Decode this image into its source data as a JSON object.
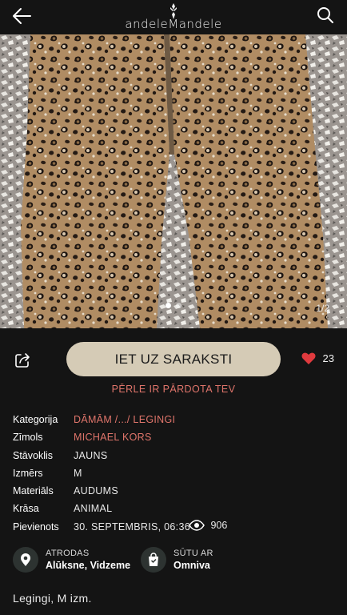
{
  "header": {
    "brand": "andeleMandele",
    "back_icon": "arrow-left-icon",
    "search_icon": "search-icon"
  },
  "gallery": {
    "pager": "1/2",
    "total": 2,
    "current": 1
  },
  "actions": {
    "cta_label": "IET UZ SARAKSTI",
    "likes": "23",
    "sold_note": "PĒRLE IR PĀRDOTA TEV"
  },
  "details": {
    "category_label": "Kategorija",
    "category_value": "DĀMĀM /.../ LEGINGI",
    "brand_label": "Zīmols",
    "brand_value": "MICHAEL KORS",
    "condition_label": "Stāvoklis",
    "condition_value": "JAUNS",
    "size_label": "Izmērs",
    "size_value": "M",
    "material_label": "Materiāls",
    "material_value": "AUDUMS",
    "color_label": "Krāsa",
    "color_value": "ANIMAL",
    "added_label": "Pievienots",
    "added_value": "30. SEPTEMBRIS, 06:36",
    "views": "906"
  },
  "location": {
    "caption": "ATRODAS",
    "value": "Alūksne, Vidzeme"
  },
  "shipping": {
    "caption": "SŪTU AR",
    "value": "Omniva"
  },
  "description": "Legingi, M izm.",
  "colors": {
    "background": "#141414",
    "accent": "#e0756b",
    "button": "#d5cbb6",
    "heart": "#e03a3e",
    "icon_circle": "#2d3331"
  }
}
